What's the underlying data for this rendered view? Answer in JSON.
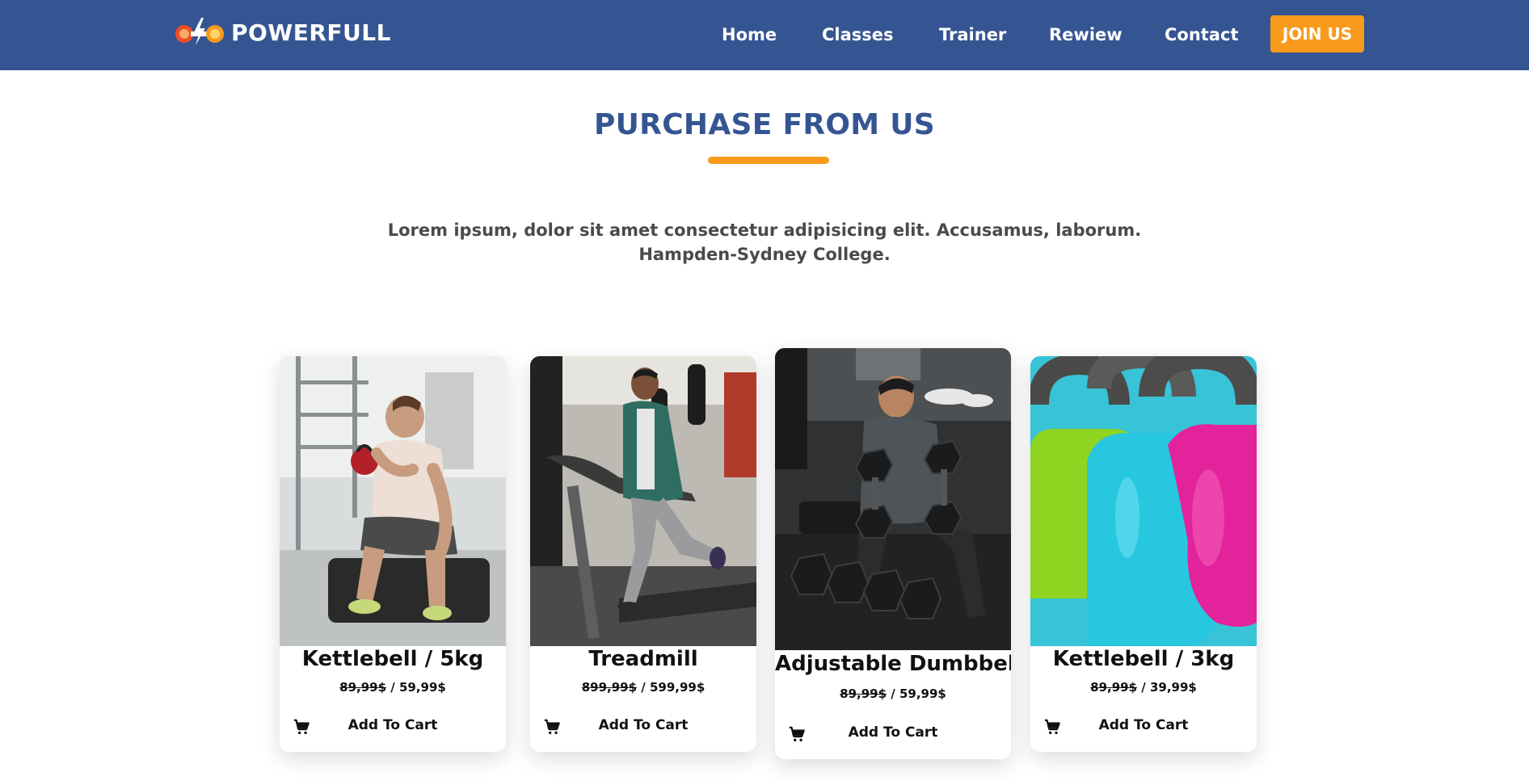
{
  "brand": {
    "name": "POWERFULL",
    "logo_icon": "dumbbell-bolt-icon",
    "colors": {
      "navy": "#355592",
      "orange": "#f89b1c"
    }
  },
  "nav": {
    "items": [
      {
        "label": "Home"
      },
      {
        "label": "Classes"
      },
      {
        "label": "Trainer"
      },
      {
        "label": "Rewiew"
      },
      {
        "label": "Contact"
      }
    ],
    "cta_label": "JOIN US"
  },
  "section": {
    "title": "PURCHASE FROM US",
    "description": "Lorem ipsum, dolor sit amet consectetur adipisicing elit. Accusamus, laborum. Hampden-Sydney College."
  },
  "products": [
    {
      "name": "Kettlebell / 5kg",
      "old_price": "89,99$",
      "separator": " / ",
      "price": "59,99$",
      "cart_label": "Add To Cart",
      "cart_icon": "cart-icon"
    },
    {
      "name": "Treadmill",
      "old_price": "899,99$",
      "separator": " / ",
      "price": "599,99$",
      "cart_label": "Add To Cart",
      "cart_icon": "cart-icon"
    },
    {
      "name": "Adjustable Dumbbell",
      "old_price": "89,99$",
      "separator": " / ",
      "price": "59,99$",
      "cart_label": "Add To Cart",
      "cart_icon": "cart-icon"
    },
    {
      "name": "Kettlebell / 3kg",
      "old_price": "89,99$",
      "separator": " / ",
      "price": "39,99$",
      "cart_label": "Add To Cart",
      "cart_icon": "cart-icon"
    }
  ]
}
